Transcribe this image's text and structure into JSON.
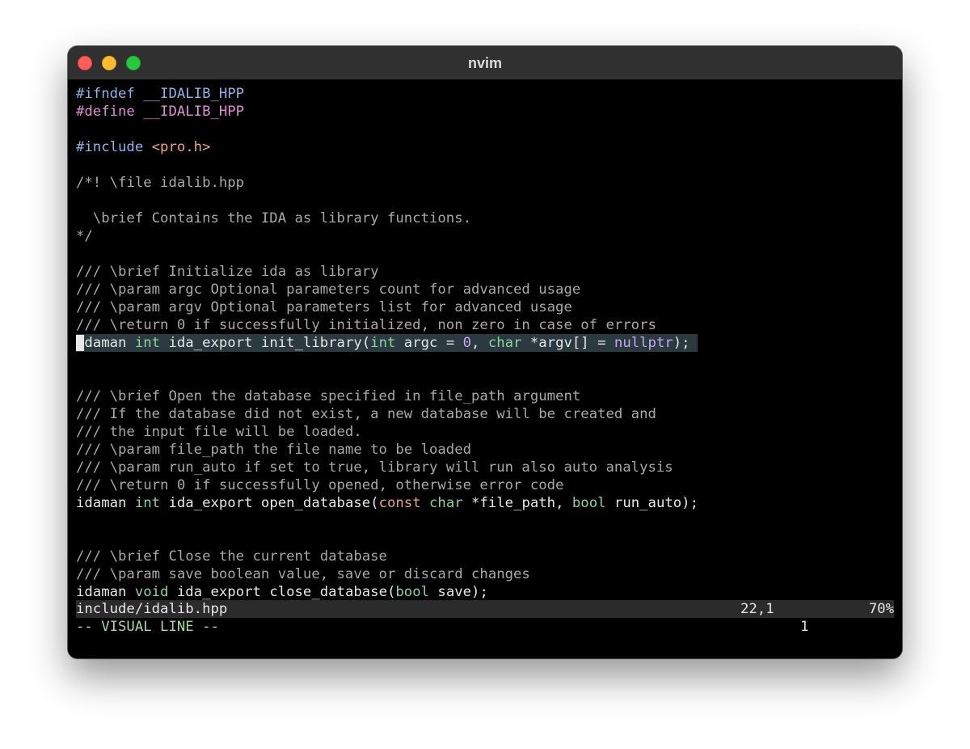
{
  "window": {
    "title": "nvim"
  },
  "colors": {
    "preproc": "#8cb4ea",
    "define": "#e08fd6",
    "include_path": "#e8a484",
    "comment": "#a8a8a8",
    "type": "#8fd19e",
    "number": "#c6a7f0",
    "plain": "#e6e6e6",
    "mode": "#a8d8a0"
  },
  "buffer": {
    "lines": [
      [
        {
          "t": "#ifndef __IDALIB_HPP",
          "c": "preproc"
        }
      ],
      [
        {
          "t": "#define __IDALIB_HPP",
          "c": "define"
        }
      ],
      [],
      [
        {
          "t": "#include ",
          "c": "preproc"
        },
        {
          "t": "<pro.h>",
          "c": "include_path"
        }
      ],
      [],
      [
        {
          "t": "/*! \\file idalib.hpp",
          "c": "comment"
        }
      ],
      [],
      [
        {
          "t": "  \\brief Contains the IDA as library functions.",
          "c": "comment"
        }
      ],
      [
        {
          "t": "*/",
          "c": "comment"
        }
      ],
      [],
      [
        {
          "t": "/// \\brief Initialize ida as library",
          "c": "comment"
        }
      ],
      [
        {
          "t": "/// \\param argc Optional parameters count for advanced usage",
          "c": "comment"
        }
      ],
      [
        {
          "t": "/// \\param argv Optional parameters list for advanced usage",
          "c": "comment"
        }
      ],
      [
        {
          "t": "/// \\return 0 if successfully initialized, non zero in case of errors",
          "c": "comment"
        }
      ],
      [
        {
          "t": "i",
          "c": "plain",
          "cursor": true
        },
        {
          "t": "daman ",
          "c": "plain"
        },
        {
          "t": "int",
          "c": "type"
        },
        {
          "t": " ida_export init_library(",
          "c": "plain"
        },
        {
          "t": "int",
          "c": "type"
        },
        {
          "t": " argc = ",
          "c": "plain"
        },
        {
          "t": "0",
          "c": "number"
        },
        {
          "t": ", ",
          "c": "plain"
        },
        {
          "t": "char",
          "c": "type"
        },
        {
          "t": " *argv[] = ",
          "c": "plain"
        },
        {
          "t": "nullptr",
          "c": "number"
        },
        {
          "t": ");",
          "c": "plain"
        }
      ],
      [],
      [],
      [
        {
          "t": "/// \\brief Open the database specified in file_path argument",
          "c": "comment"
        }
      ],
      [
        {
          "t": "/// If the database did not exist, a new database will be created and",
          "c": "comment"
        }
      ],
      [
        {
          "t": "/// the input file will be loaded.",
          "c": "comment"
        }
      ],
      [
        {
          "t": "/// \\param file_path the file name to be loaded",
          "c": "comment"
        }
      ],
      [
        {
          "t": "/// \\param run_auto if set to true, library will run also auto analysis",
          "c": "comment"
        }
      ],
      [
        {
          "t": "/// \\return 0 if successfully opened, otherwise error code",
          "c": "comment"
        }
      ],
      [
        {
          "t": "idaman ",
          "c": "plain"
        },
        {
          "t": "int",
          "c": "type"
        },
        {
          "t": " ida_export open_database(",
          "c": "plain"
        },
        {
          "t": "const",
          "c": "include_path"
        },
        {
          "t": " ",
          "c": "plain"
        },
        {
          "t": "char",
          "c": "type"
        },
        {
          "t": " *file_path, ",
          "c": "plain"
        },
        {
          "t": "bool",
          "c": "type"
        },
        {
          "t": " run_auto);",
          "c": "plain"
        }
      ],
      [],
      [],
      [
        {
          "t": "/// \\brief Close the current database",
          "c": "comment"
        }
      ],
      [
        {
          "t": "/// \\param save boolean value, save or discard changes",
          "c": "comment"
        }
      ],
      [
        {
          "t": "idaman ",
          "c": "plain"
        },
        {
          "t": "void",
          "c": "type"
        },
        {
          "t": " ida_export close_database(",
          "c": "plain"
        },
        {
          "t": "bool",
          "c": "type"
        },
        {
          "t": " save);",
          "c": "plain"
        }
      ]
    ]
  },
  "statusline": {
    "file": "include/idalib.hpp",
    "position": "22,1",
    "percent": "70%"
  },
  "cmdline": {
    "mode": "-- VISUAL LINE --",
    "showcmd": "1"
  }
}
